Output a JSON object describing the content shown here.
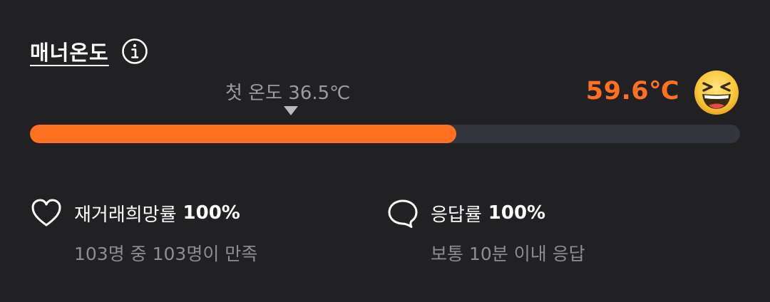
{
  "manner": {
    "title": "매너온도",
    "info_icon": "info-circle-icon",
    "first_temp_label": "첫 온도 36.5℃",
    "current_temp": "59.6℃",
    "current_temp_value": 59.6,
    "progress_fraction": 0.6,
    "emoji": "laughing-face-emoji",
    "accent_color": "#ff7020",
    "track_color": "#33363d"
  },
  "stats": {
    "rehire": {
      "icon": "heart-outline-icon",
      "label": "재거래희망률",
      "value": "100%",
      "sub": "103명 중 103명이 만족"
    },
    "response": {
      "icon": "speech-bubble-icon",
      "label": "응답률",
      "value": "100%",
      "sub": "보통 10분 이내 응답"
    }
  }
}
